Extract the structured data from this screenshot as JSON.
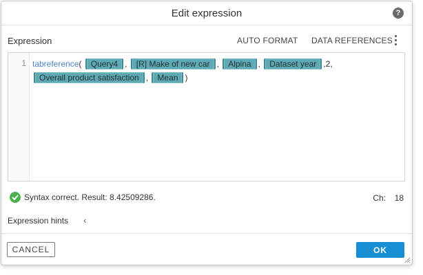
{
  "dialog": {
    "title": "Edit expression",
    "help_icon": "question-circle-icon"
  },
  "toolbar": {
    "section_label": "Expression",
    "auto_format_label": "AUTO FORMAT",
    "data_references_label": "DATA REFERENCES",
    "more_icon": "kebab-icon"
  },
  "editor": {
    "line_number": "1",
    "function_name": "tabreference",
    "open_paren": "(",
    "close_paren": ")",
    "separator": ",",
    "number_arg": "2",
    "tokens": [
      "Query4",
      "[R] Make of new car",
      "Alpina",
      "Dataset year",
      "Overall product satisfaction",
      "Mean"
    ]
  },
  "status": {
    "text": "Syntax correct. Result: 8.42509286.",
    "ch_label": "Ch:",
    "ch_value": "18",
    "color": "#4caf50"
  },
  "hints": {
    "label": "Expression hints"
  },
  "footer": {
    "cancel_label": "CANCEL",
    "ok_label": "OK",
    "ok_color": "#1a8ed3"
  },
  "colors": {
    "token_bg": "#5fa9b4",
    "function_text": "#4a86c8"
  }
}
